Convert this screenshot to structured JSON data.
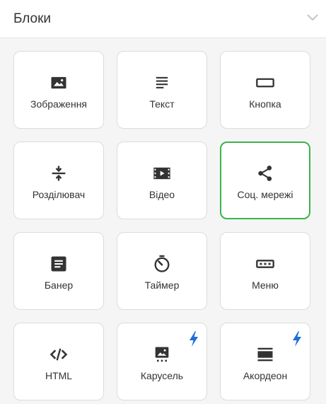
{
  "header": {
    "title": "Блоки"
  },
  "blocks": [
    {
      "label": "Зображення",
      "icon": "image-icon"
    },
    {
      "label": "Текст",
      "icon": "text-icon"
    },
    {
      "label": "Кнопка",
      "icon": "button-icon"
    },
    {
      "label": "Розділювач",
      "icon": "divider-icon"
    },
    {
      "label": "Відео",
      "icon": "video-icon"
    },
    {
      "label": "Соц. мережі",
      "icon": "share-icon",
      "selected": true
    },
    {
      "label": "Банер",
      "icon": "banner-icon"
    },
    {
      "label": "Таймер",
      "icon": "timer-icon"
    },
    {
      "label": "Меню",
      "icon": "menu-icon"
    },
    {
      "label": "HTML",
      "icon": "code-icon"
    },
    {
      "label": "Карусель",
      "icon": "carousel-icon",
      "premium": true
    },
    {
      "label": "Акордеон",
      "icon": "accordion-icon",
      "premium": true
    }
  ],
  "colors": {
    "selected_border": "#3ab54a",
    "bolt": "#1e6fd6",
    "icon": "#333333"
  }
}
